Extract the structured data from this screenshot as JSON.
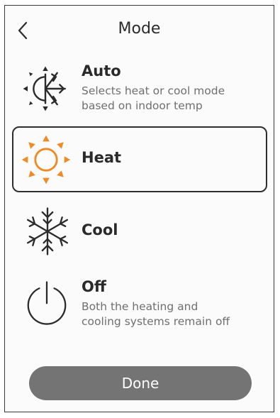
{
  "header": {
    "title": "Mode",
    "back_icon": "chevron-left-icon"
  },
  "options": [
    {
      "label": "Auto",
      "description": "Selects heat or cool mode\nbased on indoor temp",
      "icon": "sun-snowflake-icon",
      "selected": false
    },
    {
      "label": "Heat",
      "description": "",
      "icon": "sun-icon",
      "selected": true
    },
    {
      "label": "Cool",
      "description": "",
      "icon": "snowflake-icon",
      "selected": false
    },
    {
      "label": "Off",
      "description": "Both the heating and\ncooling systems remain off",
      "icon": "power-icon",
      "selected": false
    }
  ],
  "done_label": "Done",
  "colors": {
    "heat_accent": "#f08a24",
    "button": "#747474",
    "text": "#2b2b2b",
    "description": "#6f6f6f"
  }
}
